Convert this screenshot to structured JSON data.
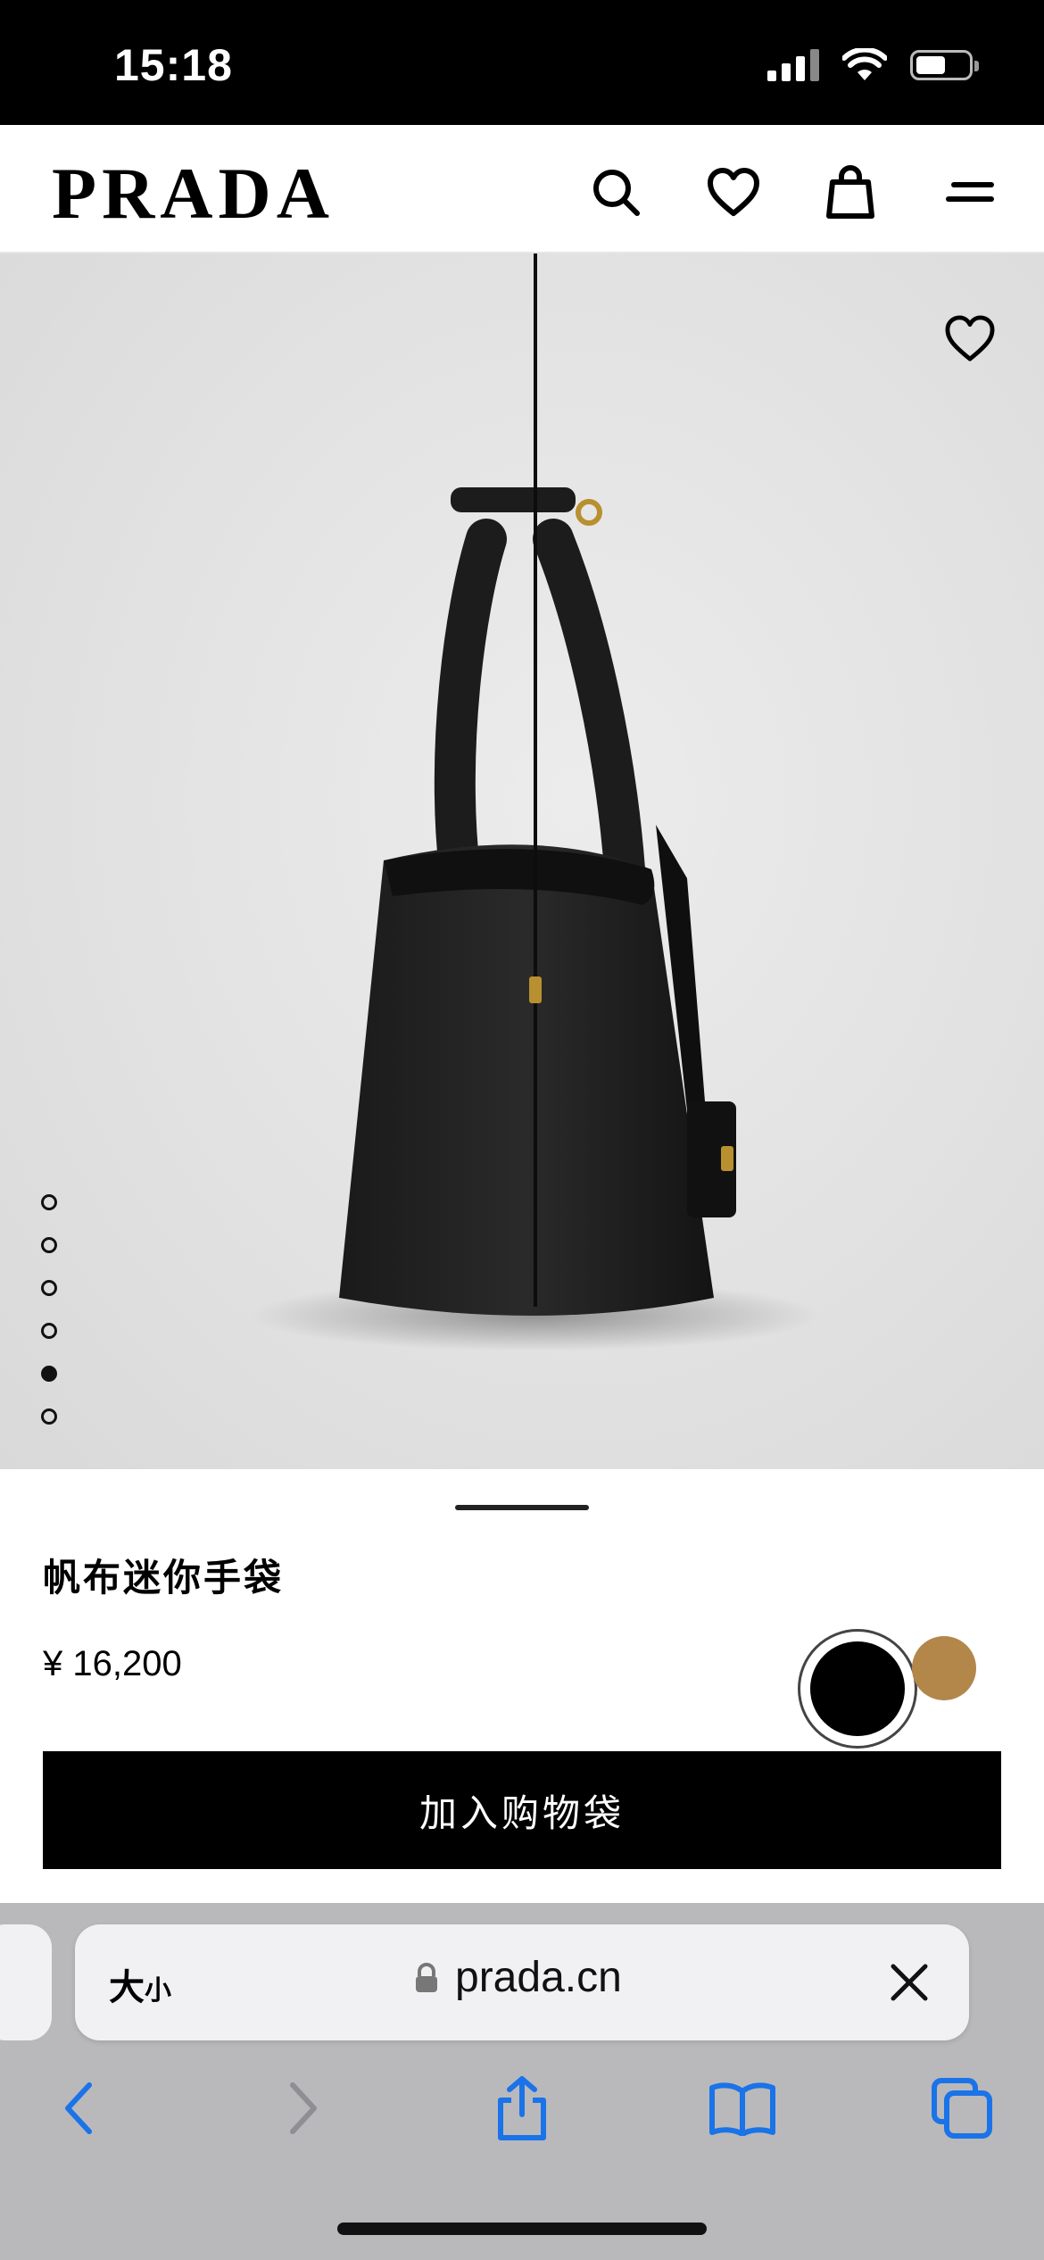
{
  "status_bar": {
    "time": "15:18"
  },
  "header": {
    "logo": "PRADA",
    "icons": [
      "search-icon",
      "heart-icon",
      "shopping-bag-icon",
      "menu-icon"
    ]
  },
  "gallery": {
    "image_count": 6,
    "active_index": 4
  },
  "product": {
    "name": "帆布迷你手袋",
    "price": "¥ 16,200",
    "colors": [
      {
        "name": "black",
        "hex": "#000000",
        "selected": true
      },
      {
        "name": "tan",
        "hex": "#b3864a",
        "selected": false
      }
    ],
    "add_to_bag_label": "加入购物袋"
  },
  "browser": {
    "text_size_label": "大",
    "text_size_small": "小",
    "url": "prada.cn",
    "accent_color": "#1a73e8"
  }
}
